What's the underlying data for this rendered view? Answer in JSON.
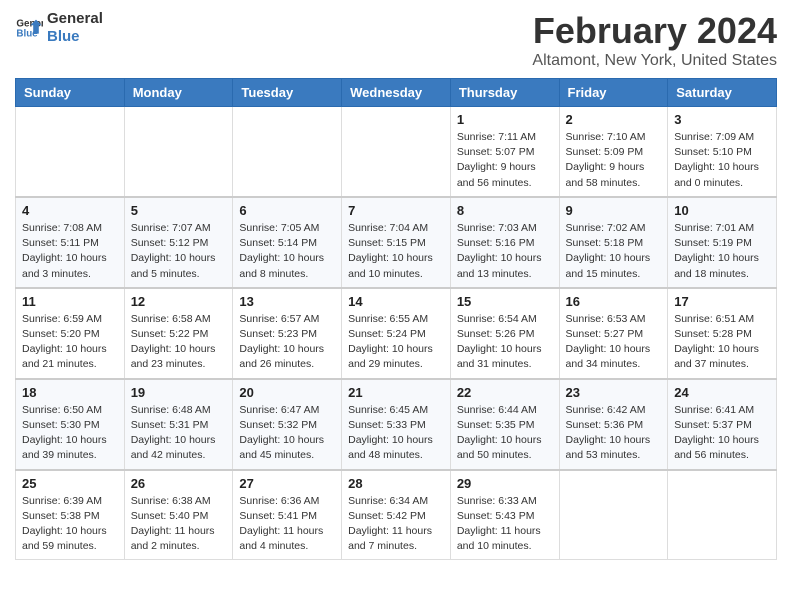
{
  "header": {
    "logo_line1": "General",
    "logo_line2": "Blue",
    "month_year": "February 2024",
    "location": "Altamont, New York, United States"
  },
  "columns": [
    "Sunday",
    "Monday",
    "Tuesday",
    "Wednesday",
    "Thursday",
    "Friday",
    "Saturday"
  ],
  "weeks": [
    [
      {
        "day": "",
        "info": ""
      },
      {
        "day": "",
        "info": ""
      },
      {
        "day": "",
        "info": ""
      },
      {
        "day": "",
        "info": ""
      },
      {
        "day": "1",
        "info": "Sunrise: 7:11 AM\nSunset: 5:07 PM\nDaylight: 9 hours and 56 minutes."
      },
      {
        "day": "2",
        "info": "Sunrise: 7:10 AM\nSunset: 5:09 PM\nDaylight: 9 hours and 58 minutes."
      },
      {
        "day": "3",
        "info": "Sunrise: 7:09 AM\nSunset: 5:10 PM\nDaylight: 10 hours and 0 minutes."
      }
    ],
    [
      {
        "day": "4",
        "info": "Sunrise: 7:08 AM\nSunset: 5:11 PM\nDaylight: 10 hours and 3 minutes."
      },
      {
        "day": "5",
        "info": "Sunrise: 7:07 AM\nSunset: 5:12 PM\nDaylight: 10 hours and 5 minutes."
      },
      {
        "day": "6",
        "info": "Sunrise: 7:05 AM\nSunset: 5:14 PM\nDaylight: 10 hours and 8 minutes."
      },
      {
        "day": "7",
        "info": "Sunrise: 7:04 AM\nSunset: 5:15 PM\nDaylight: 10 hours and 10 minutes."
      },
      {
        "day": "8",
        "info": "Sunrise: 7:03 AM\nSunset: 5:16 PM\nDaylight: 10 hours and 13 minutes."
      },
      {
        "day": "9",
        "info": "Sunrise: 7:02 AM\nSunset: 5:18 PM\nDaylight: 10 hours and 15 minutes."
      },
      {
        "day": "10",
        "info": "Sunrise: 7:01 AM\nSunset: 5:19 PM\nDaylight: 10 hours and 18 minutes."
      }
    ],
    [
      {
        "day": "11",
        "info": "Sunrise: 6:59 AM\nSunset: 5:20 PM\nDaylight: 10 hours and 21 minutes."
      },
      {
        "day": "12",
        "info": "Sunrise: 6:58 AM\nSunset: 5:22 PM\nDaylight: 10 hours and 23 minutes."
      },
      {
        "day": "13",
        "info": "Sunrise: 6:57 AM\nSunset: 5:23 PM\nDaylight: 10 hours and 26 minutes."
      },
      {
        "day": "14",
        "info": "Sunrise: 6:55 AM\nSunset: 5:24 PM\nDaylight: 10 hours and 29 minutes."
      },
      {
        "day": "15",
        "info": "Sunrise: 6:54 AM\nSunset: 5:26 PM\nDaylight: 10 hours and 31 minutes."
      },
      {
        "day": "16",
        "info": "Sunrise: 6:53 AM\nSunset: 5:27 PM\nDaylight: 10 hours and 34 minutes."
      },
      {
        "day": "17",
        "info": "Sunrise: 6:51 AM\nSunset: 5:28 PM\nDaylight: 10 hours and 37 minutes."
      }
    ],
    [
      {
        "day": "18",
        "info": "Sunrise: 6:50 AM\nSunset: 5:30 PM\nDaylight: 10 hours and 39 minutes."
      },
      {
        "day": "19",
        "info": "Sunrise: 6:48 AM\nSunset: 5:31 PM\nDaylight: 10 hours and 42 minutes."
      },
      {
        "day": "20",
        "info": "Sunrise: 6:47 AM\nSunset: 5:32 PM\nDaylight: 10 hours and 45 minutes."
      },
      {
        "day": "21",
        "info": "Sunrise: 6:45 AM\nSunset: 5:33 PM\nDaylight: 10 hours and 48 minutes."
      },
      {
        "day": "22",
        "info": "Sunrise: 6:44 AM\nSunset: 5:35 PM\nDaylight: 10 hours and 50 minutes."
      },
      {
        "day": "23",
        "info": "Sunrise: 6:42 AM\nSunset: 5:36 PM\nDaylight: 10 hours and 53 minutes."
      },
      {
        "day": "24",
        "info": "Sunrise: 6:41 AM\nSunset: 5:37 PM\nDaylight: 10 hours and 56 minutes."
      }
    ],
    [
      {
        "day": "25",
        "info": "Sunrise: 6:39 AM\nSunset: 5:38 PM\nDaylight: 10 hours and 59 minutes."
      },
      {
        "day": "26",
        "info": "Sunrise: 6:38 AM\nSunset: 5:40 PM\nDaylight: 11 hours and 2 minutes."
      },
      {
        "day": "27",
        "info": "Sunrise: 6:36 AM\nSunset: 5:41 PM\nDaylight: 11 hours and 4 minutes."
      },
      {
        "day": "28",
        "info": "Sunrise: 6:34 AM\nSunset: 5:42 PM\nDaylight: 11 hours and 7 minutes."
      },
      {
        "day": "29",
        "info": "Sunrise: 6:33 AM\nSunset: 5:43 PM\nDaylight: 11 hours and 10 minutes."
      },
      {
        "day": "",
        "info": ""
      },
      {
        "day": "",
        "info": ""
      }
    ]
  ]
}
